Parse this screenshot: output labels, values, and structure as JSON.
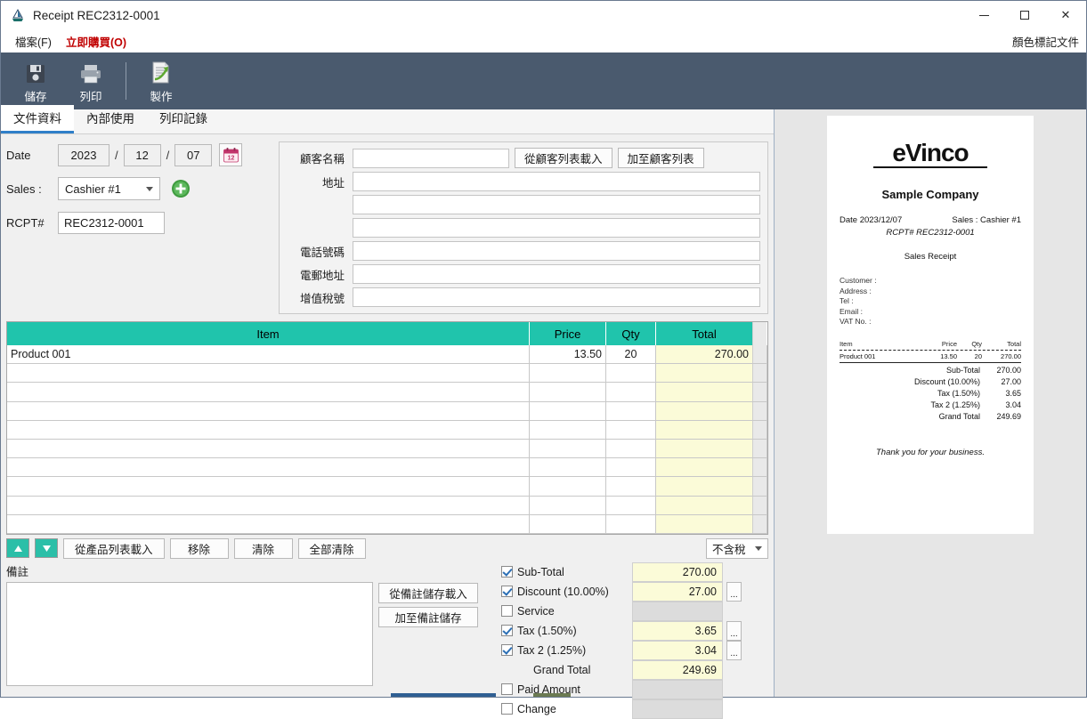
{
  "window": {
    "title": "Receipt REC2312-0001",
    "minimize": "—",
    "maximize": "□",
    "close": "✕"
  },
  "menu": {
    "file": "檔案(F)",
    "file_plain": "檔案",
    "file_key": "F",
    "buy_now": "立即購買(O)",
    "color_mark": "顏色標記文件"
  },
  "toolbar": {
    "save": "儲存",
    "print": "列印",
    "create": "製作"
  },
  "tabs": [
    {
      "label": "文件資料",
      "active": true
    },
    {
      "label": "內部使用",
      "active": false
    },
    {
      "label": "列印記錄",
      "active": false
    }
  ],
  "form": {
    "date_label": "Date",
    "date_year": "2023",
    "date_month": "12",
    "date_day": "07",
    "date_sep": "/",
    "calendar_day": "12",
    "sales_label": "Sales :",
    "sales_value": "Cashier #1",
    "rcpt_label": "RCPT#",
    "rcpt_value": "REC2312-0001"
  },
  "customer": {
    "name_label": "顧客名稱",
    "name_value": "",
    "load_from_list": "從顧客列表載入",
    "add_to_list": "加至顧客列表",
    "address_label": "地址",
    "address1": "",
    "address2": "",
    "address3": "",
    "phone_label": "電話號碼",
    "phone_value": "",
    "email_label": "電郵地址",
    "email_value": "",
    "vat_label": "增值稅號",
    "vat_value": ""
  },
  "grid": {
    "headers": {
      "item": "Item",
      "price": "Price",
      "qty": "Qty",
      "total": "Total"
    },
    "rows": [
      {
        "item": "Product 001",
        "price": "13.50",
        "qty": "20",
        "total": "270.00"
      },
      {
        "item": "",
        "price": "",
        "qty": "",
        "total": ""
      },
      {
        "item": "",
        "price": "",
        "qty": "",
        "total": ""
      },
      {
        "item": "",
        "price": "",
        "qty": "",
        "total": ""
      },
      {
        "item": "",
        "price": "",
        "qty": "",
        "total": ""
      },
      {
        "item": "",
        "price": "",
        "qty": "",
        "total": ""
      },
      {
        "item": "",
        "price": "",
        "qty": "",
        "total": ""
      },
      {
        "item": "",
        "price": "",
        "qty": "",
        "total": ""
      },
      {
        "item": "",
        "price": "",
        "qty": "",
        "total": ""
      },
      {
        "item": "",
        "price": "",
        "qty": "",
        "total": ""
      }
    ]
  },
  "actions": {
    "move_up": "▲",
    "move_down": "▼",
    "load_products": "從產品列表載入",
    "remove": "移除",
    "clear": "清除",
    "clear_all": "全部清除",
    "tax_mode": "不含稅"
  },
  "notes": {
    "label": "備註",
    "value": "",
    "load_note": "從備註儲存載入",
    "save_note": "加至備註儲存"
  },
  "totals": [
    {
      "label": "Sub-Total",
      "value": "270.00",
      "checked": true,
      "checkbox": true,
      "edit": false,
      "gray": false
    },
    {
      "label": "Discount (10.00%)",
      "value": "27.00",
      "checked": true,
      "checkbox": true,
      "edit": true,
      "gray": false
    },
    {
      "label": "Service",
      "value": "",
      "checked": false,
      "checkbox": true,
      "edit": false,
      "gray": true
    },
    {
      "label": "Tax (1.50%)",
      "value": "3.65",
      "checked": true,
      "checkbox": true,
      "edit": true,
      "gray": false
    },
    {
      "label": "Tax 2 (1.25%)",
      "value": "3.04",
      "checked": true,
      "checkbox": true,
      "edit": true,
      "gray": false
    },
    {
      "label": "Grand Total",
      "value": "249.69",
      "checked": false,
      "checkbox": false,
      "edit": false,
      "gray": false
    },
    {
      "label": "Paid Amount",
      "value": "",
      "checked": false,
      "checkbox": true,
      "edit": false,
      "gray": true
    },
    {
      "label": "Change",
      "value": "",
      "checked": false,
      "checkbox": true,
      "edit": false,
      "gray": true
    }
  ],
  "preview": {
    "logo": "eVinco",
    "company": "Sample Company",
    "date_line": "Date 2023/12/07",
    "sales_line": "Sales : Cashier #1",
    "rcpt_line": "RCPT# REC2312-0001",
    "doc_type": "Sales Receipt",
    "customer_lines": [
      "Customer :",
      "Address :",
      "Tel :",
      "Email :",
      "VAT No. :"
    ],
    "table_headers": {
      "item": "Item",
      "price": "Price",
      "qty": "Qty",
      "total": "Total"
    },
    "table_rows": [
      {
        "item": "Product 001",
        "price": "13.50",
        "qty": "20",
        "total": "270.00"
      }
    ],
    "summary": [
      {
        "label": "Sub-Total",
        "value": "270.00"
      },
      {
        "label": "Discount (10.00%)",
        "value": "27.00"
      },
      {
        "label": "Tax (1.50%)",
        "value": "3.65"
      },
      {
        "label": "Tax 2 (1.25%)",
        "value": "3.04"
      },
      {
        "label": "Grand Total",
        "value": "249.69"
      }
    ],
    "thanks": "Thank you for your business."
  },
  "colors": {
    "toolbar_bg": "#4a5a6e",
    "grid_header": "#20c4ac",
    "value_field": "#fbfbd8",
    "accent_tab": "#2f7fc8",
    "buy_now": "#c00000"
  }
}
